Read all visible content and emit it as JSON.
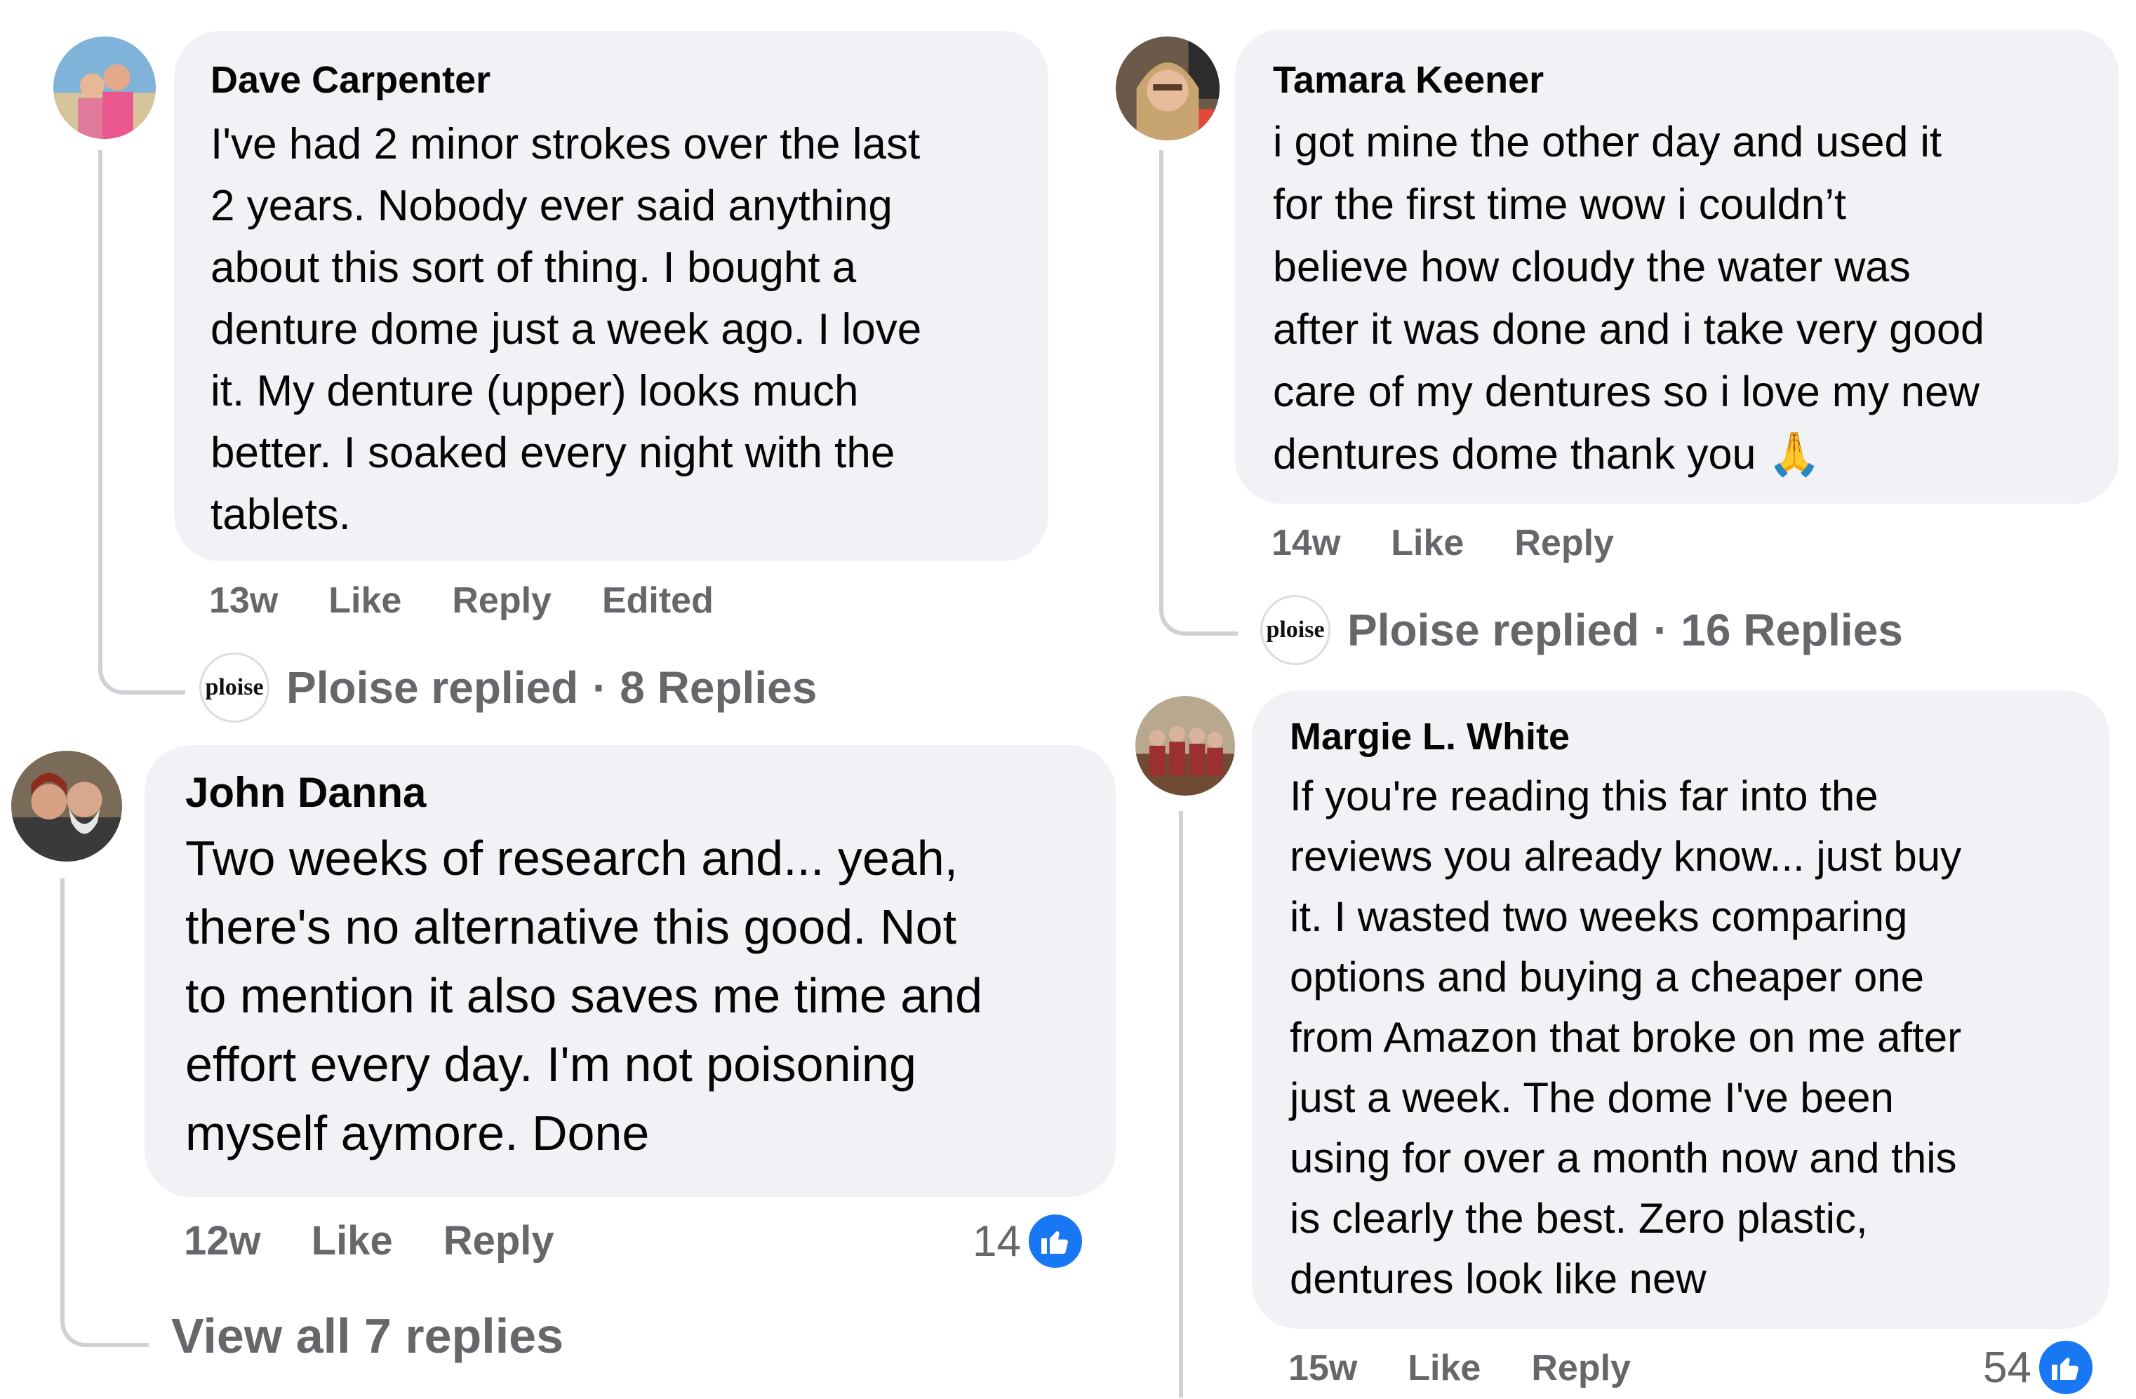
{
  "comments": {
    "dave": {
      "author": "Dave Carpenter",
      "lines": [
        "I've had 2 minor strokes over the last",
        "2 years. Nobody ever said anything",
        "about this sort of thing. I bought a",
        "denture dome just a week ago. I love",
        "it. My denture (upper) looks much",
        "better. I soaked every night with the",
        "tablets."
      ],
      "time": "13w",
      "like": "Like",
      "reply": "Reply",
      "edited": "Edited",
      "replied_by": "Ploise replied",
      "replies": "· 8 Replies"
    },
    "john": {
      "author": "John Danna",
      "lines": [
        "Two weeks of research and... yeah,",
        "there's no alternative this good. Not",
        "to mention it also saves me time and",
        "effort every day. I'm not poisoning",
        "myself aymore. Done"
      ],
      "time": "12w",
      "like": "Like",
      "reply": "Reply",
      "reaction_count": "14",
      "view_all": "View all 7 replies"
    },
    "tamara": {
      "author": "Tamara Keener",
      "lines": [
        "i got mine the other day and used it",
        "for the first time wow i couldn’t",
        "believe how cloudy the water was",
        "after it was done and i take very good",
        "care of my dentures so i love my new",
        "dentures dome thank you 🙏"
      ],
      "time": "14w",
      "like": "Like",
      "reply": "Reply",
      "replied_by": "Ploise replied",
      "replies": "· 16 Replies"
    },
    "margie": {
      "author": "Margie L. White",
      "lines": [
        "If you're reading this far into the",
        "reviews you already know... just buy",
        "it. I wasted two weeks comparing",
        "options and buying a cheaper one",
        "from Amazon that broke on me after",
        "just a week. The dome I've been",
        "using for over a month now and this",
        "is clearly the best. Zero plastic,",
        "dentures look like new"
      ],
      "time": "15w",
      "like": "Like",
      "reply": "Reply",
      "reaction_count": "54"
    }
  },
  "ploise_logo_text": "ploise",
  "icons": {
    "like_badge": "thumbs-up-icon",
    "avatar": "avatar-photo"
  },
  "colors": {
    "bubble": "#f0f2f5",
    "secondary_text": "#65676b",
    "like_blue": "#1877f2",
    "thread_line": "#ced0d4"
  }
}
